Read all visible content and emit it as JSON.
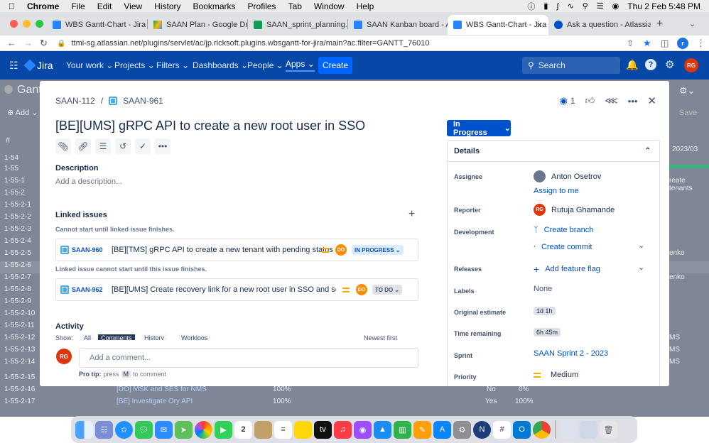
{
  "menubar": {
    "app": "Chrome",
    "items": [
      "File",
      "Edit",
      "View",
      "History",
      "Bookmarks",
      "Profiles",
      "Tab",
      "Window",
      "Help"
    ],
    "datetime": "Thu 2 Feb  5:48 PM"
  },
  "tabs": [
    {
      "label": "WBS Gantt-Chart - Jira",
      "active": false
    },
    {
      "label": "SAAN Plan - Google Driv",
      "active": false
    },
    {
      "label": "SAAN_sprint_planning.xl",
      "active": false
    },
    {
      "label": "SAAN Kanban board - Ag",
      "active": false
    },
    {
      "label": "WBS Gantt-Chart - Jira",
      "active": true
    },
    {
      "label": "Ask a question - Atlassia",
      "active": false
    }
  ],
  "address": {
    "url": "ttmi-sg.atlassian.net/plugins/servlet/ac/jp.ricksoft.plugins.wbsgantt-for-jira/main?ac.filter=GANTT_76010",
    "profile": "r"
  },
  "jira_nav": {
    "brand": "Jira",
    "items": [
      "Your work",
      "Projects",
      "Filters",
      "Dashboards",
      "People",
      "Apps"
    ],
    "create": "Create",
    "search_placeholder": "Search",
    "user_initials": "RG"
  },
  "background": {
    "page_title": "Gant",
    "add_label": "Add",
    "save_label": "Save",
    "col_hash": "#",
    "date_col": "2023/03",
    "rows": [
      "1-54",
      "1-55",
      "1-55-1",
      "1-55-2",
      "1-55-2-1",
      "1-55-2-2",
      "1-55-2-3",
      "1-55-2-4",
      "1-55-2-5",
      "1-55-2-6",
      "1-55-2-7",
      "1-55-2-8",
      "1-55-2-9",
      "1-55-2-10",
      "1-55-2-11",
      "1-55-2-12",
      "1-55-2-13",
      "1-55-2-14",
      "1-55-2-15",
      "1-55-2-16",
      "1-55-2-17"
    ],
    "visible_rows": [
      {
        "name": "[DO] MSK and SES for NMS",
        "pct": "100%",
        "col1": "No",
        "col2": "0%"
      },
      {
        "name": "[BE] Investigate Ory API",
        "pct": "100%",
        "col1": "Yes",
        "col2": "100%"
      }
    ],
    "side_text": [
      "reate tenants",
      "enko",
      "enko",
      "MS",
      "MS",
      "MS"
    ]
  },
  "issue": {
    "parent_key": "SAAN-112",
    "key": "SAAN-961",
    "watchers": "1",
    "title": "[BE][UMS] gRPC API to create a new root user in SSO",
    "description_label": "Description",
    "description_placeholder": "Add a description...",
    "linked_label": "Linked issues",
    "link_group1": "Cannot start until linked issue finishes.",
    "link_group2": "Linked issue cannot start until this issue finishes.",
    "links": [
      {
        "key": "SAAN-960",
        "summary": "[BE][TMS] gRPC API to create a new tenant with pending status",
        "assignee": "DO",
        "status": "IN PROGRESS"
      },
      {
        "key": "SAAN-962",
        "summary": "[BE][UMS] Create recovery link for a new root user in SSO and send ...",
        "assignee": "DO",
        "status": "TO DO"
      }
    ],
    "activity_label": "Activity",
    "activity_filters": [
      "Show:",
      "All",
      "Comments",
      "History",
      "Worklogs",
      "Newest first"
    ],
    "comment_placeholder": "Add a comment...",
    "protip_prefix": "Pro tip:",
    "protip_mid": "press",
    "protip_key": "M",
    "protip_suffix": "to comment",
    "commenter_initials": "RG",
    "status": "In Progress",
    "details_label": "Details",
    "details": {
      "assignee_label": "Assignee",
      "assignee": "Anton Osetrov",
      "assign_to_me": "Assign to me",
      "reporter_label": "Reporter",
      "reporter": "Rutuja Ghamande",
      "reporter_initials": "RG",
      "development_label": "Development",
      "create_branch": "Create branch",
      "create_commit": "Create commit",
      "releases_label": "Releases",
      "add_feature_flag": "Add feature flag",
      "labels_label": "Labels",
      "labels_value": "None",
      "original_estimate_label": "Original estimate",
      "original_estimate": "1d 1h",
      "time_remaining_label": "Time remaining",
      "time_remaining": "6h 45m",
      "sprint_label": "Sprint",
      "sprint": "SAAN Sprint 2 - 2023",
      "priority_label": "Priority",
      "priority": "Medium"
    }
  },
  "colors": {
    "jira_nav": "#0747a6",
    "primary": "#0052cc",
    "reporter_avatar": "#de350b",
    "priority": "#ffab00"
  }
}
